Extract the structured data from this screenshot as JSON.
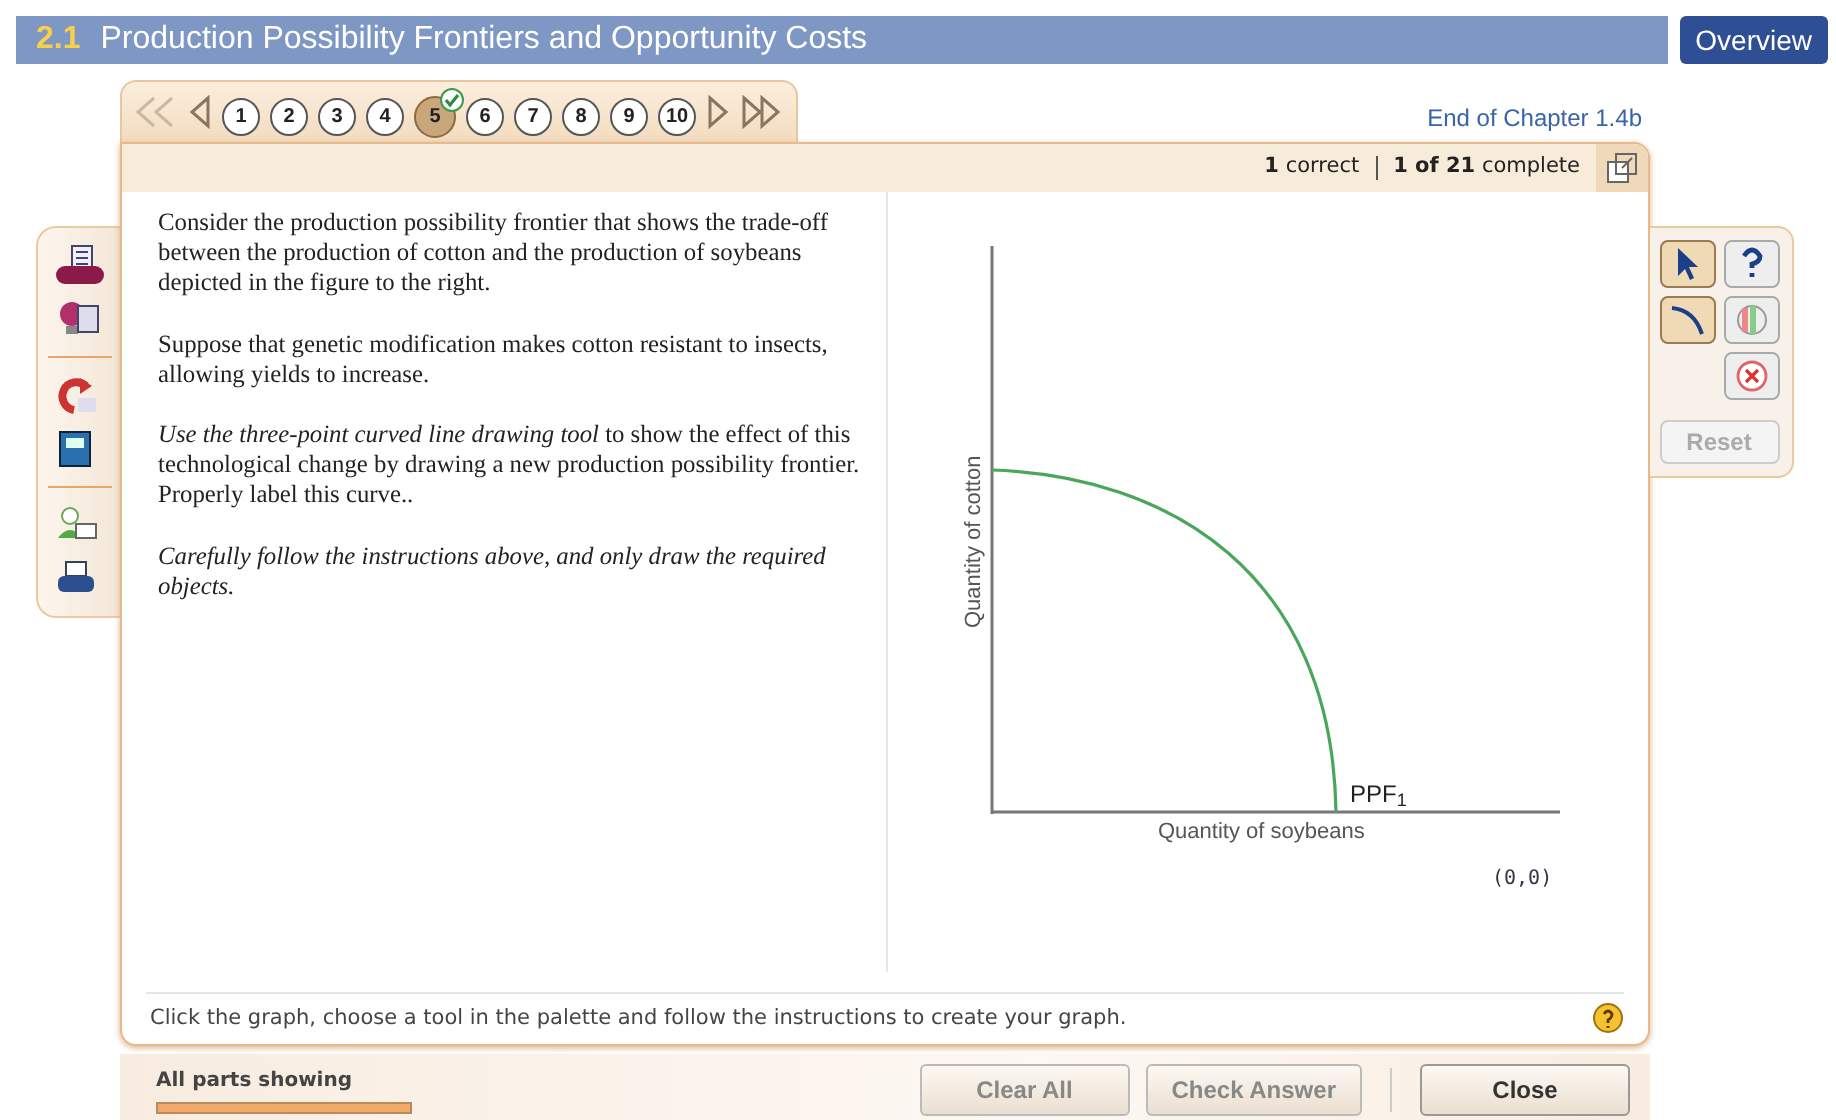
{
  "header": {
    "number": "2.1",
    "title": "Production Possibility Frontiers and Opportunity Costs",
    "overview_button": "Overview"
  },
  "question_nav": [
    {
      "label": "1",
      "selected": false,
      "answered": false
    },
    {
      "label": "2",
      "selected": false,
      "answered": false
    },
    {
      "label": "3",
      "selected": false,
      "answered": false
    },
    {
      "label": "4",
      "selected": false,
      "answered": false
    },
    {
      "label": "5",
      "selected": true,
      "answered": true
    },
    {
      "label": "6",
      "selected": false,
      "answered": false
    },
    {
      "label": "7",
      "selected": false,
      "answered": false
    },
    {
      "label": "8",
      "selected": false,
      "answered": false
    },
    {
      "label": "9",
      "selected": false,
      "answered": false
    },
    {
      "label": "10",
      "selected": false,
      "answered": false
    }
  ],
  "chapter_link": "End of Chapter 1.4b",
  "status": {
    "correct_count": "1",
    "correct_label": "correct",
    "complete_count": "1 of 21",
    "complete_label": "complete"
  },
  "instructions": [
    {
      "text": "Consider the production possibility frontier that shows the trade-off between the production of cotton and the production of soybeans depicted in the figure to the right.",
      "italic": false
    },
    {
      "text": "Suppose that genetic modification makes cotton resistant to insects, allowing yields to increase.",
      "italic": false
    },
    {
      "text": "*Use the three-point curved line drawing tool* to show the effect of this technological change by drawing a new production possibility frontier.  Properly label this curve..",
      "italic": false
    },
    {
      "text": "Carefully follow the instructions above, and only draw the required objects.",
      "italic": true
    }
  ],
  "graph": {
    "y_label": "Quantity of cotton",
    "x_label": "Quantity of soybeans",
    "curve_label": "PPF$_{1}$",
    "origin": "(0,0)"
  },
  "tool_palette": {
    "tools": [
      {
        "kind": "pointer",
        "active": true
      },
      {
        "kind": "help",
        "active": false
      },
      {
        "kind": "curve",
        "active": true
      },
      {
        "kind": "color",
        "active": false
      },
      {
        "kind": "delete",
        "active": false
      }
    ],
    "reset": {
      "label": "Reset",
      "disabled": true
    }
  },
  "hint": "Click the graph, choose a tool in the palette and follow the instructions to create your graph.",
  "parts_label": "All parts showing",
  "parts_progress": {
    "level": 1
  },
  "buttons": [
    {
      "label": "Clear All",
      "disabled": true
    },
    {
      "label": "Check Answer",
      "disabled": true
    },
    {
      "label": "Close",
      "disabled": false
    }
  ]
}
